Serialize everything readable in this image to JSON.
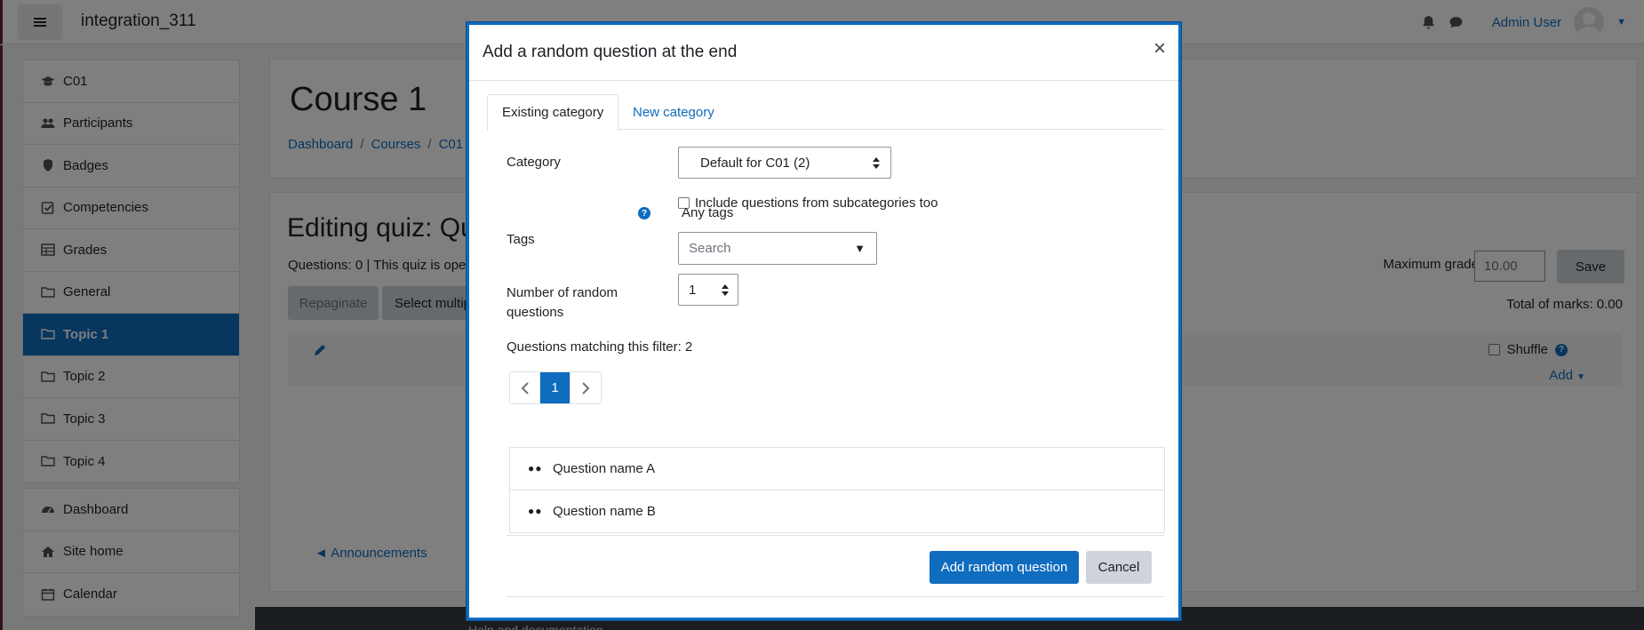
{
  "navbar": {
    "site_name": "integration_311",
    "user_name": "Admin User"
  },
  "drawer": {
    "course_items": [
      {
        "label": "C01",
        "icon": "graduation-cap-icon"
      },
      {
        "label": "Participants",
        "icon": "users-icon"
      },
      {
        "label": "Badges",
        "icon": "shield-icon"
      },
      {
        "label": "Competencies",
        "icon": "check-square-icon"
      },
      {
        "label": "Grades",
        "icon": "table-icon"
      },
      {
        "label": "General",
        "icon": "folder-icon"
      },
      {
        "label": "Topic 1",
        "icon": "folder-icon",
        "active": true
      },
      {
        "label": "Topic 2",
        "icon": "folder-icon"
      },
      {
        "label": "Topic 3",
        "icon": "folder-icon"
      },
      {
        "label": "Topic 4",
        "icon": "folder-icon"
      }
    ],
    "site_items": [
      {
        "label": "Dashboard",
        "icon": "tachometer-icon"
      },
      {
        "label": "Site home",
        "icon": "home-icon"
      },
      {
        "label": "Calendar",
        "icon": "calendar-icon"
      }
    ]
  },
  "page": {
    "course_title": "Course 1",
    "breadcrumb": [
      "Dashboard",
      "Courses",
      "C01"
    ],
    "editing_title": "Editing quiz: Qu",
    "quiz_info": "Questions: 0 | This quiz is ope",
    "repaginate": "Repaginate",
    "select_multiple": "Select multipl",
    "max_grade_label": "Maximum grade",
    "max_grade_value": "10.00",
    "save": "Save",
    "total_marks": "Total of marks: 0.00",
    "shuffle": "Shuffle",
    "add": "Add",
    "announcements": "◄ Announcements",
    "footer_help": "Help and documentation"
  },
  "modal": {
    "title": "Add a random question at the end",
    "close": "×",
    "tabs": [
      "Existing category",
      "New category"
    ],
    "category_label": "Category",
    "category_value": "Default for C01 (2)",
    "include_subcategories": "Include questions from subcategories too",
    "tags_label": "Tags",
    "any_tags": "Any tags",
    "search_placeholder": "Search",
    "number_label_line1": "Number of random",
    "number_label_line2": "questions",
    "number_value": "1",
    "matching": "Questions matching this filter: 2",
    "current_page": "1",
    "questions": [
      "Question name A",
      "Question name B"
    ],
    "add_button": "Add random question",
    "cancel_button": "Cancel"
  },
  "colors": {
    "primary": "#0f6cbf",
    "secondary_button": "#ced4da",
    "drawer_active": "#0f6cbf"
  }
}
